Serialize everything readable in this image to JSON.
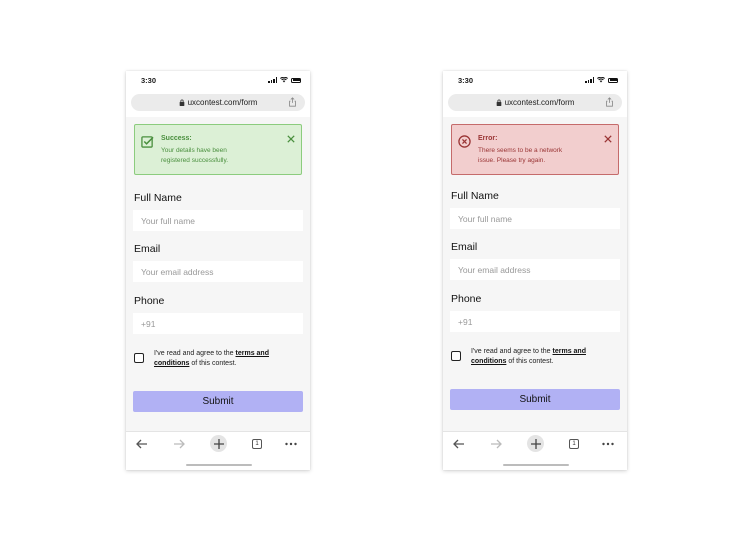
{
  "screens": [
    {
      "status_time": "3:30",
      "url": "uxcontest.com/form",
      "alert": {
        "type": "success",
        "title": "Success:",
        "line1": "Your details have been",
        "line2": "registered successfully."
      },
      "fields": [
        {
          "label": "Full Name",
          "placeholder": "Your full name"
        },
        {
          "label": "Email",
          "placeholder": "Your email address"
        },
        {
          "label": "Phone",
          "placeholder": "+91"
        }
      ],
      "terms": {
        "prefix": "I've read and agree to the ",
        "link1": "terms and",
        "link2": "conditions",
        "suffix": " of this contest."
      },
      "submit_label": "Submit",
      "tab_count": "1"
    },
    {
      "status_time": "3:30",
      "url": "uxcontest.com/form",
      "alert": {
        "type": "error",
        "title": "Error:",
        "line1": "There seems to be a network",
        "line2": "issue. Please try again."
      },
      "fields": [
        {
          "label": "Full Name",
          "placeholder": "Your full name"
        },
        {
          "label": "Email",
          "placeholder": "Your email address"
        },
        {
          "label": "Phone",
          "placeholder": "+91"
        }
      ],
      "terms": {
        "prefix": "I've read and agree to the ",
        "link1": "terms and",
        "link2": "conditions",
        "suffix": " of this contest."
      },
      "submit_label": "Submit",
      "tab_count": "1"
    }
  ],
  "colors": {
    "success_bg": "#dcf0d6",
    "success_text": "#4a8f3e",
    "error_bg": "#f2cece",
    "error_text": "#9a3535",
    "submit_bg": "#b1b1f4"
  },
  "icons": {
    "success": "checkbox-check-icon",
    "error": "circle-x-icon",
    "close": "close-icon",
    "lock": "lock-icon",
    "share": "share-icon",
    "back": "arrow-left-icon",
    "forward": "arrow-right-icon",
    "new_tab": "plus-icon",
    "tabs": "tabs-icon",
    "more": "more-dots-icon"
  }
}
